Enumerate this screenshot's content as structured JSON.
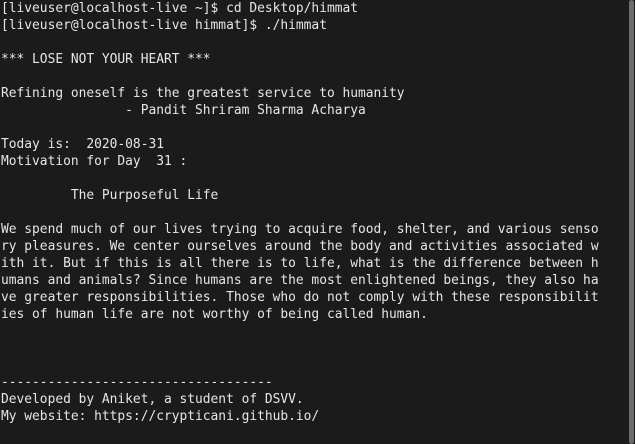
{
  "terminal": {
    "lines": [
      "[liveuser@localhost-live ~]$ cd Desktop/himmat",
      "[liveuser@localhost-live himmat]$ ./himmat",
      "",
      "*** LOSE NOT YOUR HEART ***",
      "",
      "Refining oneself is the greatest service to humanity",
      "                - Pandit Shriram Sharma Acharya",
      "",
      "Today is:  2020-08-31",
      "Motivation for Day  31 :",
      "",
      "         The Purposeful Life",
      "",
      "We spend much of our lives trying to acquire food, shelter, and various senso",
      "ry pleasures. We center ourselves around the body and activities associated w",
      "ith it. But if this is all there is to life, what is the difference between h",
      "umans and animals? Since humans are the most enlightened beings, they also ha",
      "ve greater responsibilities. Those who do not comply with these responsibilit",
      "ies of human life are not worthy of being called human.",
      "",
      "",
      "",
      "-----------------------------------",
      "Developed by Aniket, a student of DSVV.",
      "My website: https://crypticani.github.io/"
    ]
  },
  "colors": {
    "background": "#1b1b1b",
    "text": "#e6e6e6",
    "scrollbar": "#6d6d6d"
  }
}
